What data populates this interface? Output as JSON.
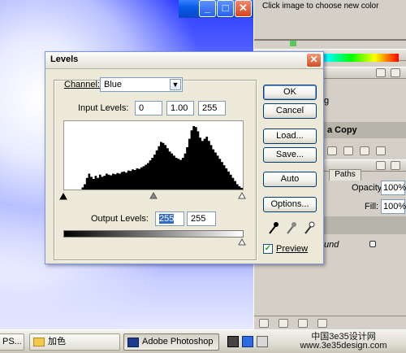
{
  "background_window": {
    "min_label": "_",
    "max_label": "□",
    "close_label": "✕"
  },
  "right_panel": {
    "color_hint": "Click image to choose new color",
    "layer_name": "a Copy",
    "tab_paths": "Paths",
    "opacity_label": "Opacity:",
    "opacity_value": "100%",
    "fill_label": "Fill:",
    "fill_value": "100%",
    "bg_layer_name": "und",
    "row_text": "g"
  },
  "dialog": {
    "title": "Levels",
    "close_label": "✕",
    "channel_label": "Channel:",
    "channel_value": "Blue",
    "input_levels_label": "Input Levels:",
    "input_levels": [
      "0",
      "1.00",
      "255"
    ],
    "output_levels_label": "Output Levels:",
    "output_levels": [
      "255",
      "255"
    ],
    "buttons": {
      "ok": "OK",
      "cancel": "Cancel",
      "load": "Load...",
      "save": "Save...",
      "auto": "Auto",
      "options": "Options..."
    },
    "preview_label": "Preview",
    "preview_checked": true
  },
  "histogram": {
    "description_free": true,
    "bins": [
      0,
      0,
      0,
      0,
      0,
      0,
      0,
      0,
      4,
      10,
      22,
      30,
      24,
      20,
      26,
      22,
      28,
      24,
      26,
      30,
      28,
      27,
      30,
      29,
      31,
      30,
      33,
      34,
      32,
      36,
      35,
      38,
      37,
      40,
      39,
      42,
      44,
      47,
      50,
      55,
      60,
      66,
      74,
      82,
      90,
      88,
      84,
      78,
      72,
      68,
      64,
      60,
      58,
      56,
      60,
      68,
      80,
      96,
      112,
      120,
      118,
      110,
      98,
      92,
      96,
      100,
      92,
      84,
      76,
      70,
      64,
      58,
      52,
      46,
      40,
      34,
      28,
      22,
      16,
      10,
      6,
      3
    ]
  },
  "taskbar": {
    "items": [
      {
        "label": "PS..."
      },
      {
        "label": "加色"
      },
      {
        "label": "Adobe Photoshop"
      }
    ],
    "watermark": "中国3e35设计网 www.3e35design.com"
  },
  "colors": {
    "xp_blue": "#0a5ce8",
    "dialog_bg": "#ece9d8",
    "close_red": "#d24f24"
  }
}
